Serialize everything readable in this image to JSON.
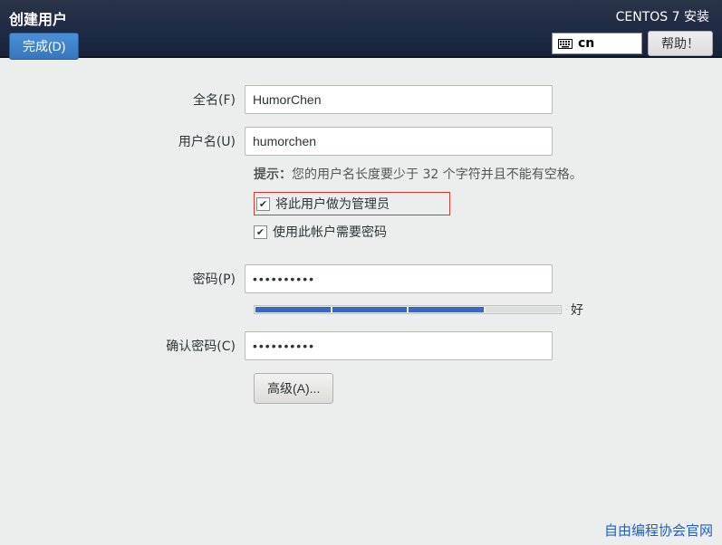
{
  "header": {
    "title": "创建用户",
    "done_label": "完成(D)",
    "subtitle": "CENTOS 7 安装",
    "keyboard_layout": "cn",
    "help_label": "帮助！"
  },
  "form": {
    "fullname_label": "全名(F)",
    "fullname_value": "HumorChen",
    "username_label": "用户名(U)",
    "username_value": "humorchen",
    "hint_prefix": "提示：",
    "hint_text": "您的用户名长度要少于 32 个字符并且不能有空格。",
    "admin_label": "将此用户做为管理员",
    "admin_checked": true,
    "require_pw_label": "使用此帐户需要密码",
    "require_pw_checked": true,
    "password_label": "密码(P)",
    "password_value": "••••••••••",
    "strength_segments": [
      true,
      true,
      true,
      false
    ],
    "strength_text": "好",
    "confirm_label": "确认密码(C)",
    "confirm_value": "••••••••••",
    "advanced_label": "高级(A)..."
  },
  "footer": {
    "link_text": "自由编程协会官网"
  }
}
